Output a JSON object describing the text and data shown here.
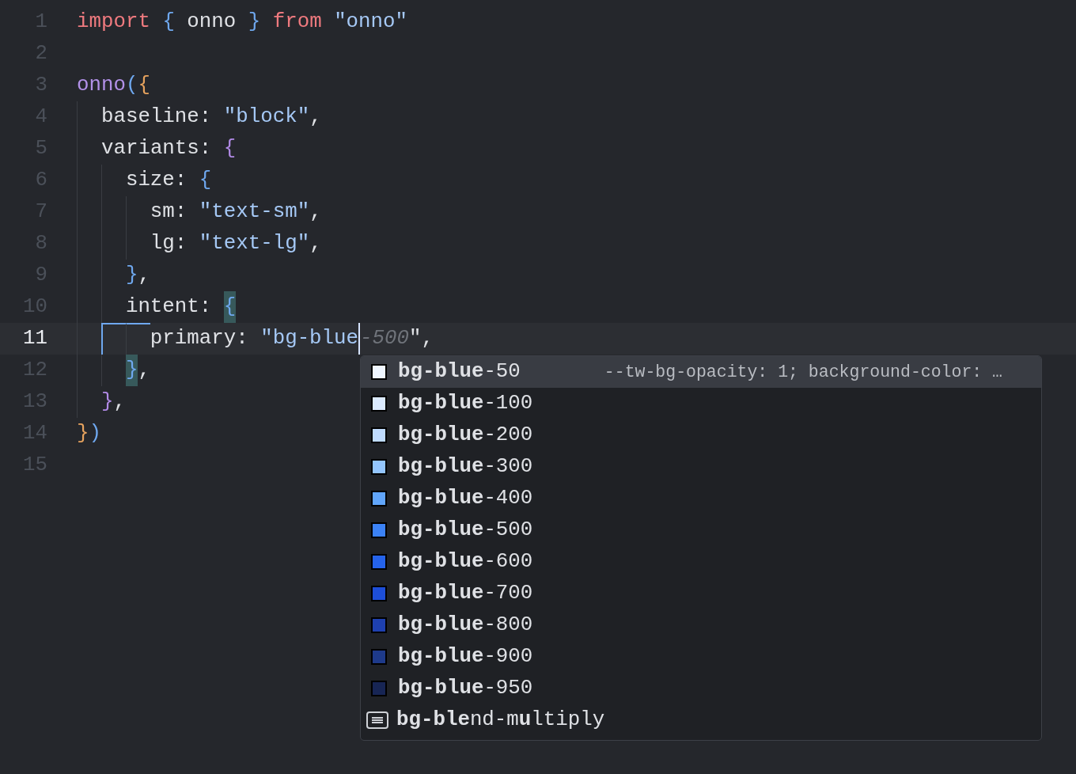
{
  "editor": {
    "lines": [
      {
        "number": "1",
        "current": false,
        "tokens": [
          {
            "text": "import ",
            "kind": "keyword"
          },
          {
            "text": "{",
            "kind": "brace-blue"
          },
          {
            "text": " onno ",
            "kind": "plain"
          },
          {
            "text": "} ",
            "kind": "brace-blue"
          },
          {
            "text": "from ",
            "kind": "keyword"
          },
          {
            "text": "\"onno\"",
            "kind": "string"
          }
        ]
      },
      {
        "number": "2",
        "current": false
      },
      {
        "number": "3",
        "current": false,
        "tokens": [
          {
            "text": "onno",
            "kind": "function"
          },
          {
            "text": "(",
            "kind": "brace-blue"
          },
          {
            "text": "{",
            "kind": "brace-orange"
          }
        ]
      },
      {
        "number": "4",
        "current": false,
        "tokens": [
          {
            "text": "  baseline: ",
            "kind": "plain"
          },
          {
            "text": "\"block\"",
            "kind": "string"
          },
          {
            "text": ",",
            "kind": "plain"
          }
        ]
      },
      {
        "number": "5",
        "current": false,
        "tokens": [
          {
            "text": "  variants: ",
            "kind": "plain"
          },
          {
            "text": "{",
            "kind": "brace-purple"
          }
        ]
      },
      {
        "number": "6",
        "current": false,
        "tokens": [
          {
            "text": "    size: ",
            "kind": "plain"
          },
          {
            "text": "{",
            "kind": "brace-blue"
          }
        ]
      },
      {
        "number": "7",
        "current": false,
        "tokens": [
          {
            "text": "      sm: ",
            "kind": "plain"
          },
          {
            "text": "\"text-sm\"",
            "kind": "string"
          },
          {
            "text": ",",
            "kind": "plain"
          }
        ]
      },
      {
        "number": "8",
        "current": false,
        "tokens": [
          {
            "text": "      lg: ",
            "kind": "plain"
          },
          {
            "text": "\"text-lg\"",
            "kind": "string"
          },
          {
            "text": ",",
            "kind": "plain"
          }
        ]
      },
      {
        "number": "9",
        "current": false,
        "tokens": [
          {
            "text": "    }",
            "kind": "brace-blue"
          },
          {
            "text": ",",
            "kind": "plain"
          }
        ]
      },
      {
        "number": "10",
        "current": false,
        "tokens": [
          {
            "text": "    intent: ",
            "kind": "plain"
          },
          {
            "text": "{",
            "kind": "brace-blue",
            "matched": true
          }
        ]
      },
      {
        "number": "11",
        "current": true,
        "tokens": [
          {
            "text": "      primary: ",
            "kind": "plain"
          },
          {
            "text": "\"bg-blue",
            "kind": "string"
          },
          {
            "text": "-500",
            "kind": "ghost"
          },
          {
            "text": "\",",
            "kind": "plain"
          }
        ]
      },
      {
        "number": "12",
        "current": false,
        "tokens": [
          {
            "text": "    }",
            "kind": "brace-blue",
            "matched": true
          },
          {
            "text": ",",
            "kind": "plain"
          }
        ]
      },
      {
        "number": "13",
        "current": false,
        "tokens": [
          {
            "text": "  }",
            "kind": "brace-purple"
          },
          {
            "text": ",",
            "kind": "plain"
          }
        ]
      },
      {
        "number": "14",
        "current": false,
        "tokens": [
          {
            "text": "}",
            "kind": "brace-orange"
          },
          {
            "text": ")",
            "kind": "brace-blue"
          }
        ]
      },
      {
        "number": "15",
        "current": false
      }
    ]
  },
  "completion": {
    "items": [
      {
        "kind": "color",
        "label": "**bg-blue**-50",
        "color": "#eff6ff",
        "selected": true,
        "detail": "--tw-bg-opacity: 1; background-color: …"
      },
      {
        "kind": "color",
        "label": "**bg-blue**-100",
        "color": "#dbeafe",
        "selected": false
      },
      {
        "kind": "color",
        "label": "**bg-blue**-200",
        "color": "#bfdbfe",
        "selected": false
      },
      {
        "kind": "color",
        "label": "**bg-blue**-300",
        "color": "#93c5fd",
        "selected": false
      },
      {
        "kind": "color",
        "label": "**bg-blue**-400",
        "color": "#60a5fa",
        "selected": false
      },
      {
        "kind": "color",
        "label": "**bg-blue**-500",
        "color": "#3b82f6",
        "selected": false
      },
      {
        "kind": "color",
        "label": "**bg-blue**-600",
        "color": "#2563eb",
        "selected": false
      },
      {
        "kind": "color",
        "label": "**bg-blue**-700",
        "color": "#1d4ed8",
        "selected": false
      },
      {
        "kind": "color",
        "label": "**bg-blue**-800",
        "color": "#1e40af",
        "selected": false
      },
      {
        "kind": "color",
        "label": "**bg-blue**-900",
        "color": "#1e3a8a",
        "selected": false
      },
      {
        "kind": "color",
        "label": "**bg-blue**-950",
        "color": "#172554",
        "selected": false
      },
      {
        "kind": "text",
        "label": "**bg-ble**nd-m**u**ltiply",
        "selected": false
      }
    ]
  }
}
